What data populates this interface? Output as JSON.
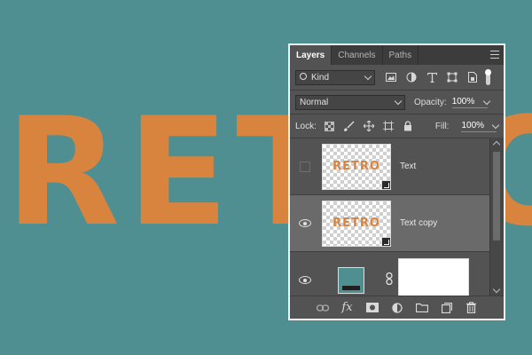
{
  "canvas": {
    "text": "RETRO",
    "text_color": "#d8843f",
    "background": "#4f8f91"
  },
  "panel": {
    "tabs": [
      {
        "label": "Layers",
        "active": true
      },
      {
        "label": "Channels",
        "active": false
      },
      {
        "label": "Paths",
        "active": false
      }
    ],
    "filter": {
      "kind_label": "Kind",
      "icons": [
        "image-filter-icon",
        "adjustment-filter-icon",
        "type-filter-icon",
        "shape-filter-icon",
        "smart-object-filter-icon",
        "filter-toggle"
      ]
    },
    "blend_mode": "Normal",
    "opacity_label": "Opacity:",
    "opacity_value": "100%",
    "lock_label": "Lock:",
    "fill_label": "Fill:",
    "fill_value": "100%",
    "layers": [
      {
        "name": "Text",
        "thumb_text": "RETRO",
        "visible": false,
        "selected": false
      },
      {
        "name": "Text copy",
        "thumb_text": "RETRO",
        "visible": true,
        "selected": true
      },
      {
        "name": "",
        "type": "adjustment-with-mask",
        "visible": true,
        "selected": false
      }
    ],
    "bottom_icons": [
      "link-layers-icon",
      "fx-icon",
      "add-mask-icon",
      "adjustment-layer-icon",
      "group-folder-icon",
      "new-layer-icon",
      "trash-icon"
    ]
  }
}
